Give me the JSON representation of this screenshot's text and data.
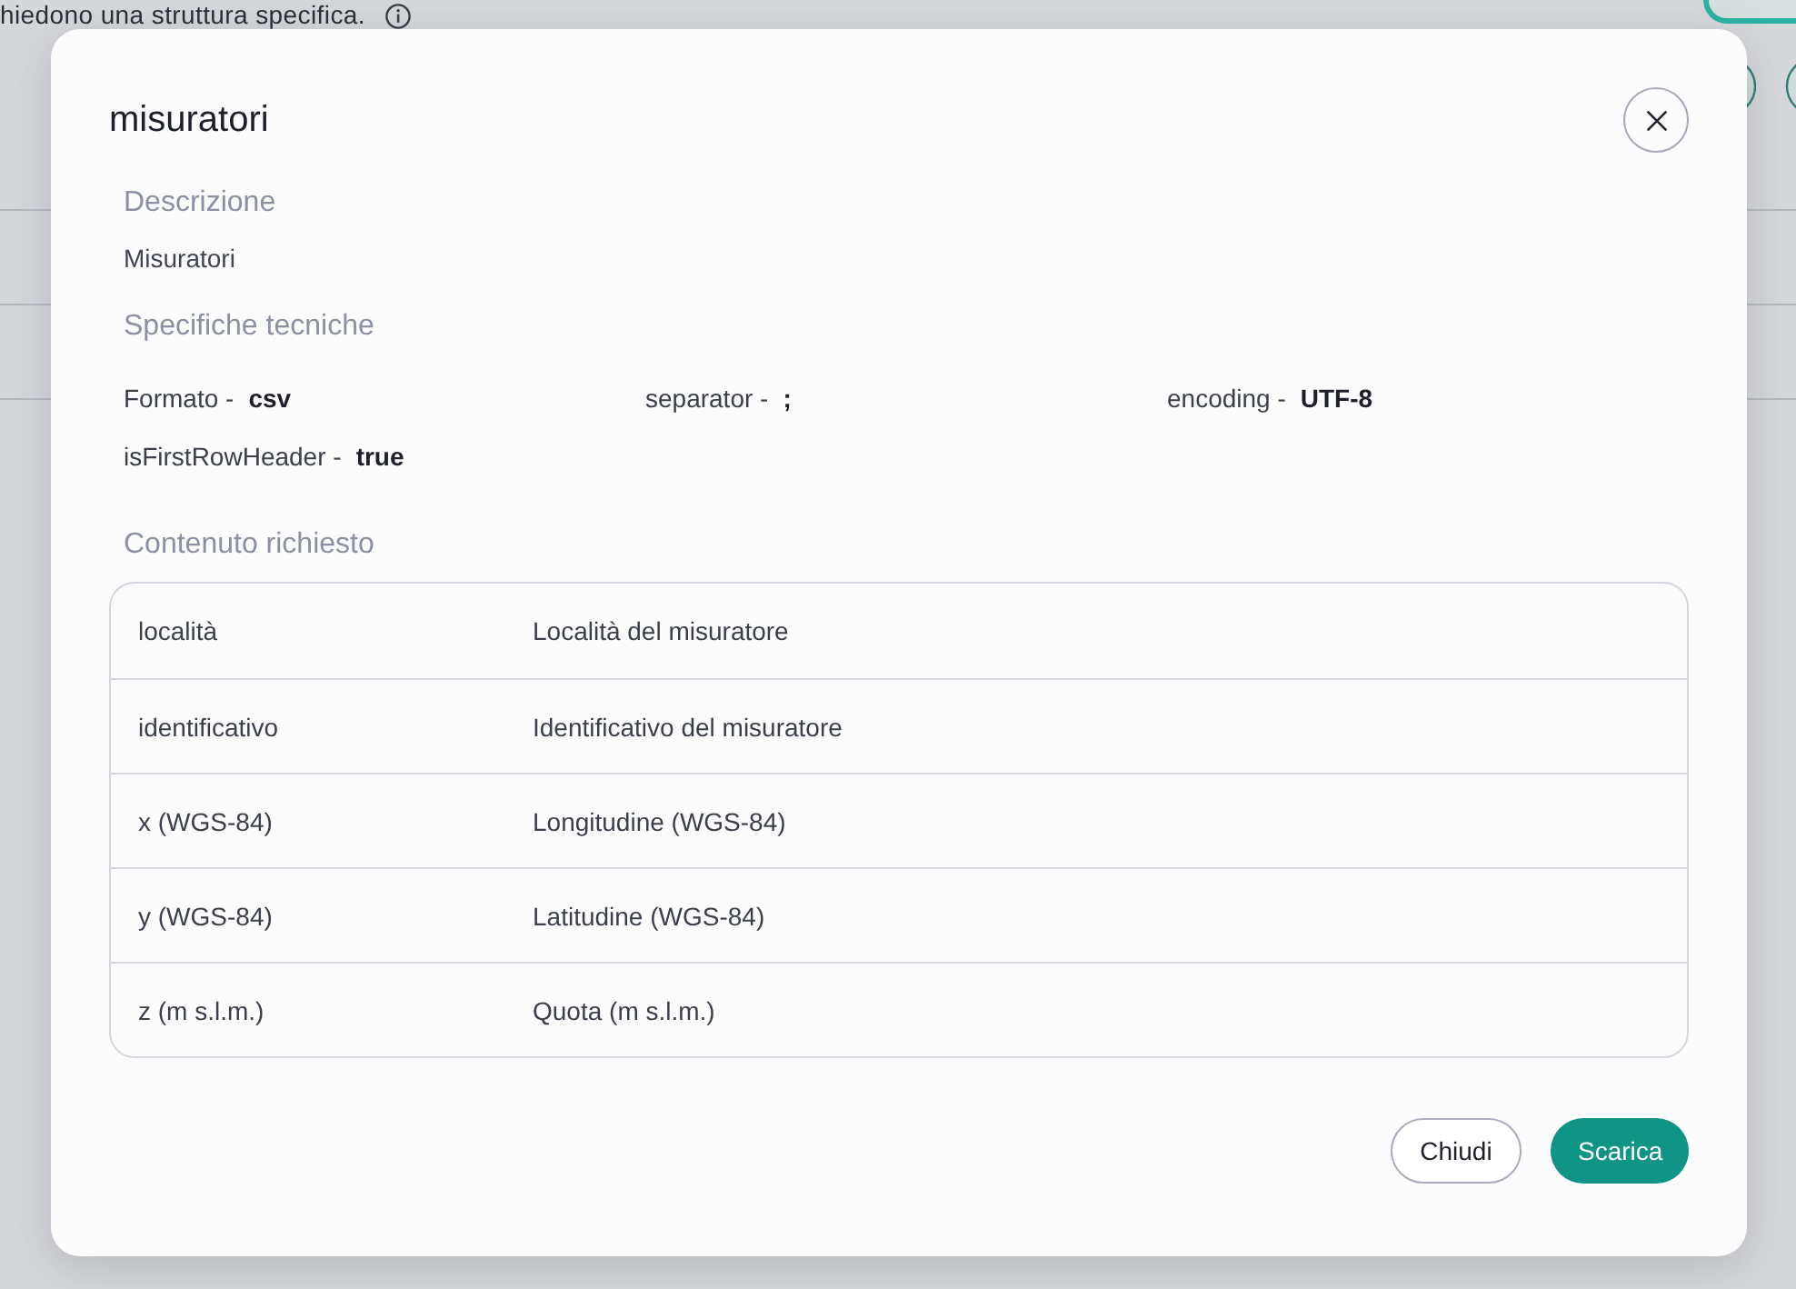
{
  "background_page": {
    "notice": "hiedono una struttura specifica."
  },
  "dialog": {
    "title": "misuratori",
    "description_heading": "Descrizione",
    "description": "Misuratori",
    "specs_heading": "Specifiche tecniche",
    "specs": [
      {
        "label": "Formato -",
        "value": "csv"
      },
      {
        "label": "separator -",
        "value": ";"
      },
      {
        "label": "encoding -",
        "value": "UTF-8"
      },
      {
        "label": "isFirstRowHeader -",
        "value": "true"
      }
    ],
    "content_heading": "Contenuto richiesto",
    "fields": [
      {
        "name": "località",
        "description": "Località del misuratore"
      },
      {
        "name": "identificativo",
        "description": "Identificativo del misuratore"
      },
      {
        "name": "x (WGS-84)",
        "description": "Longitudine (WGS-84)"
      },
      {
        "name": "y (WGS-84)",
        "description": "Latitudine (WGS-84)"
      },
      {
        "name": "z (m s.l.m.)",
        "description": "Quota (m s.l.m.)"
      }
    ],
    "buttons": [
      {
        "label": "Chiudi",
        "kind": "secondary"
      },
      {
        "label": "Scarica",
        "kind": "primary"
      }
    ]
  }
}
